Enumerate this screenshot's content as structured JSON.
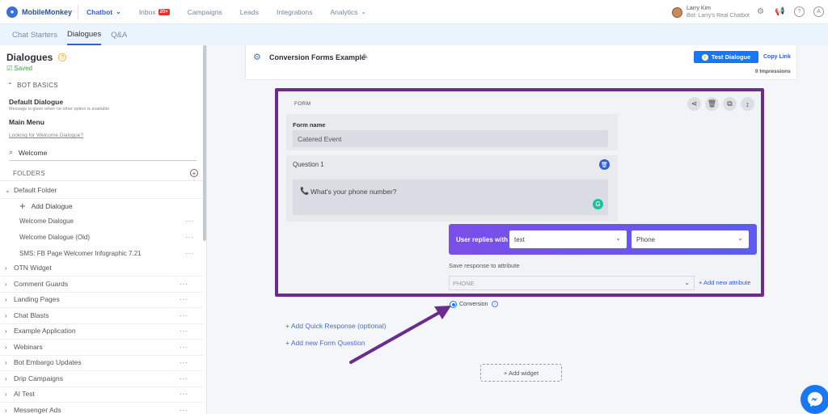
{
  "nav": {
    "logo_text": "MobileMonkey",
    "items": [
      {
        "label": "Chatbot",
        "active": true,
        "dropdown": true
      },
      {
        "label": "Inbox",
        "badge": "20+"
      },
      {
        "label": "Campaigns"
      },
      {
        "label": "Leads"
      },
      {
        "label": "Integrations"
      },
      {
        "label": "Analytics",
        "dropdown": true
      }
    ],
    "user_name": "Larry Kim",
    "user_bot": "Bot: Larry's Real Chatbot",
    "icons": [
      "gear-icon",
      "megaphone-icon",
      "help-icon",
      "account-icon"
    ]
  },
  "subnav": {
    "tabs": [
      {
        "label": "Chat Starters"
      },
      {
        "label": "Dialogues",
        "active": true
      },
      {
        "label": "Q&A"
      }
    ]
  },
  "sidebar": {
    "title": "Dialogues",
    "saved": "Saved",
    "bot_basics": "BOT BASICS",
    "default_dialogue": "Default Dialogue",
    "default_desc": "Message is given when no other option is available",
    "main_menu": "Main Menu",
    "welcome_link": "Looking for Welcome Dialogue?",
    "search_value": "Welcome",
    "folders_label": "FOLDERS",
    "default_folder": "Default Folder",
    "add_dialogue": "Add Dialogue",
    "default_folder_items": [
      "Welcome Dialogue",
      "Welcome Dialogue (Old)",
      "SMS: FB Page Welcomer Infographic 7.21"
    ],
    "folders": [
      "OTN Widget",
      "Comment Guards",
      "Landing Pages",
      "Chat Blasts",
      "Example Application",
      "Webinars",
      "Bot Embargo Updates",
      "Drip Campaigns",
      "AI Test",
      "Messenger Ads"
    ]
  },
  "header": {
    "title": "Conversion Forms Example",
    "test_button": "Test Dialogue",
    "copy_link": "Copy Link",
    "impressions": "0 Impressions"
  },
  "form": {
    "label": "FORM",
    "form_name_label": "Form name",
    "form_name_value": "Catered Event",
    "question_label": "Question 1",
    "question_text": "What's your phone number?",
    "user_replies_label": "User replies with",
    "reply_type": "text",
    "reply_validation": "Phone",
    "save_response_label": "Save response to attribute",
    "attribute_value": "PHONE",
    "add_attribute": "+ Add new attribute",
    "conversion_label": "Conversion",
    "conversion_checked": true
  },
  "actions": {
    "add_quick_response": "+ Add Quick Response (optional)",
    "add_form_question": "+ Add new Form Question",
    "add_widget": "+ Add widget"
  },
  "colors": {
    "accent": "#2f5fd0",
    "frame": "#6a2d8f",
    "messenger": "#1877f2"
  }
}
